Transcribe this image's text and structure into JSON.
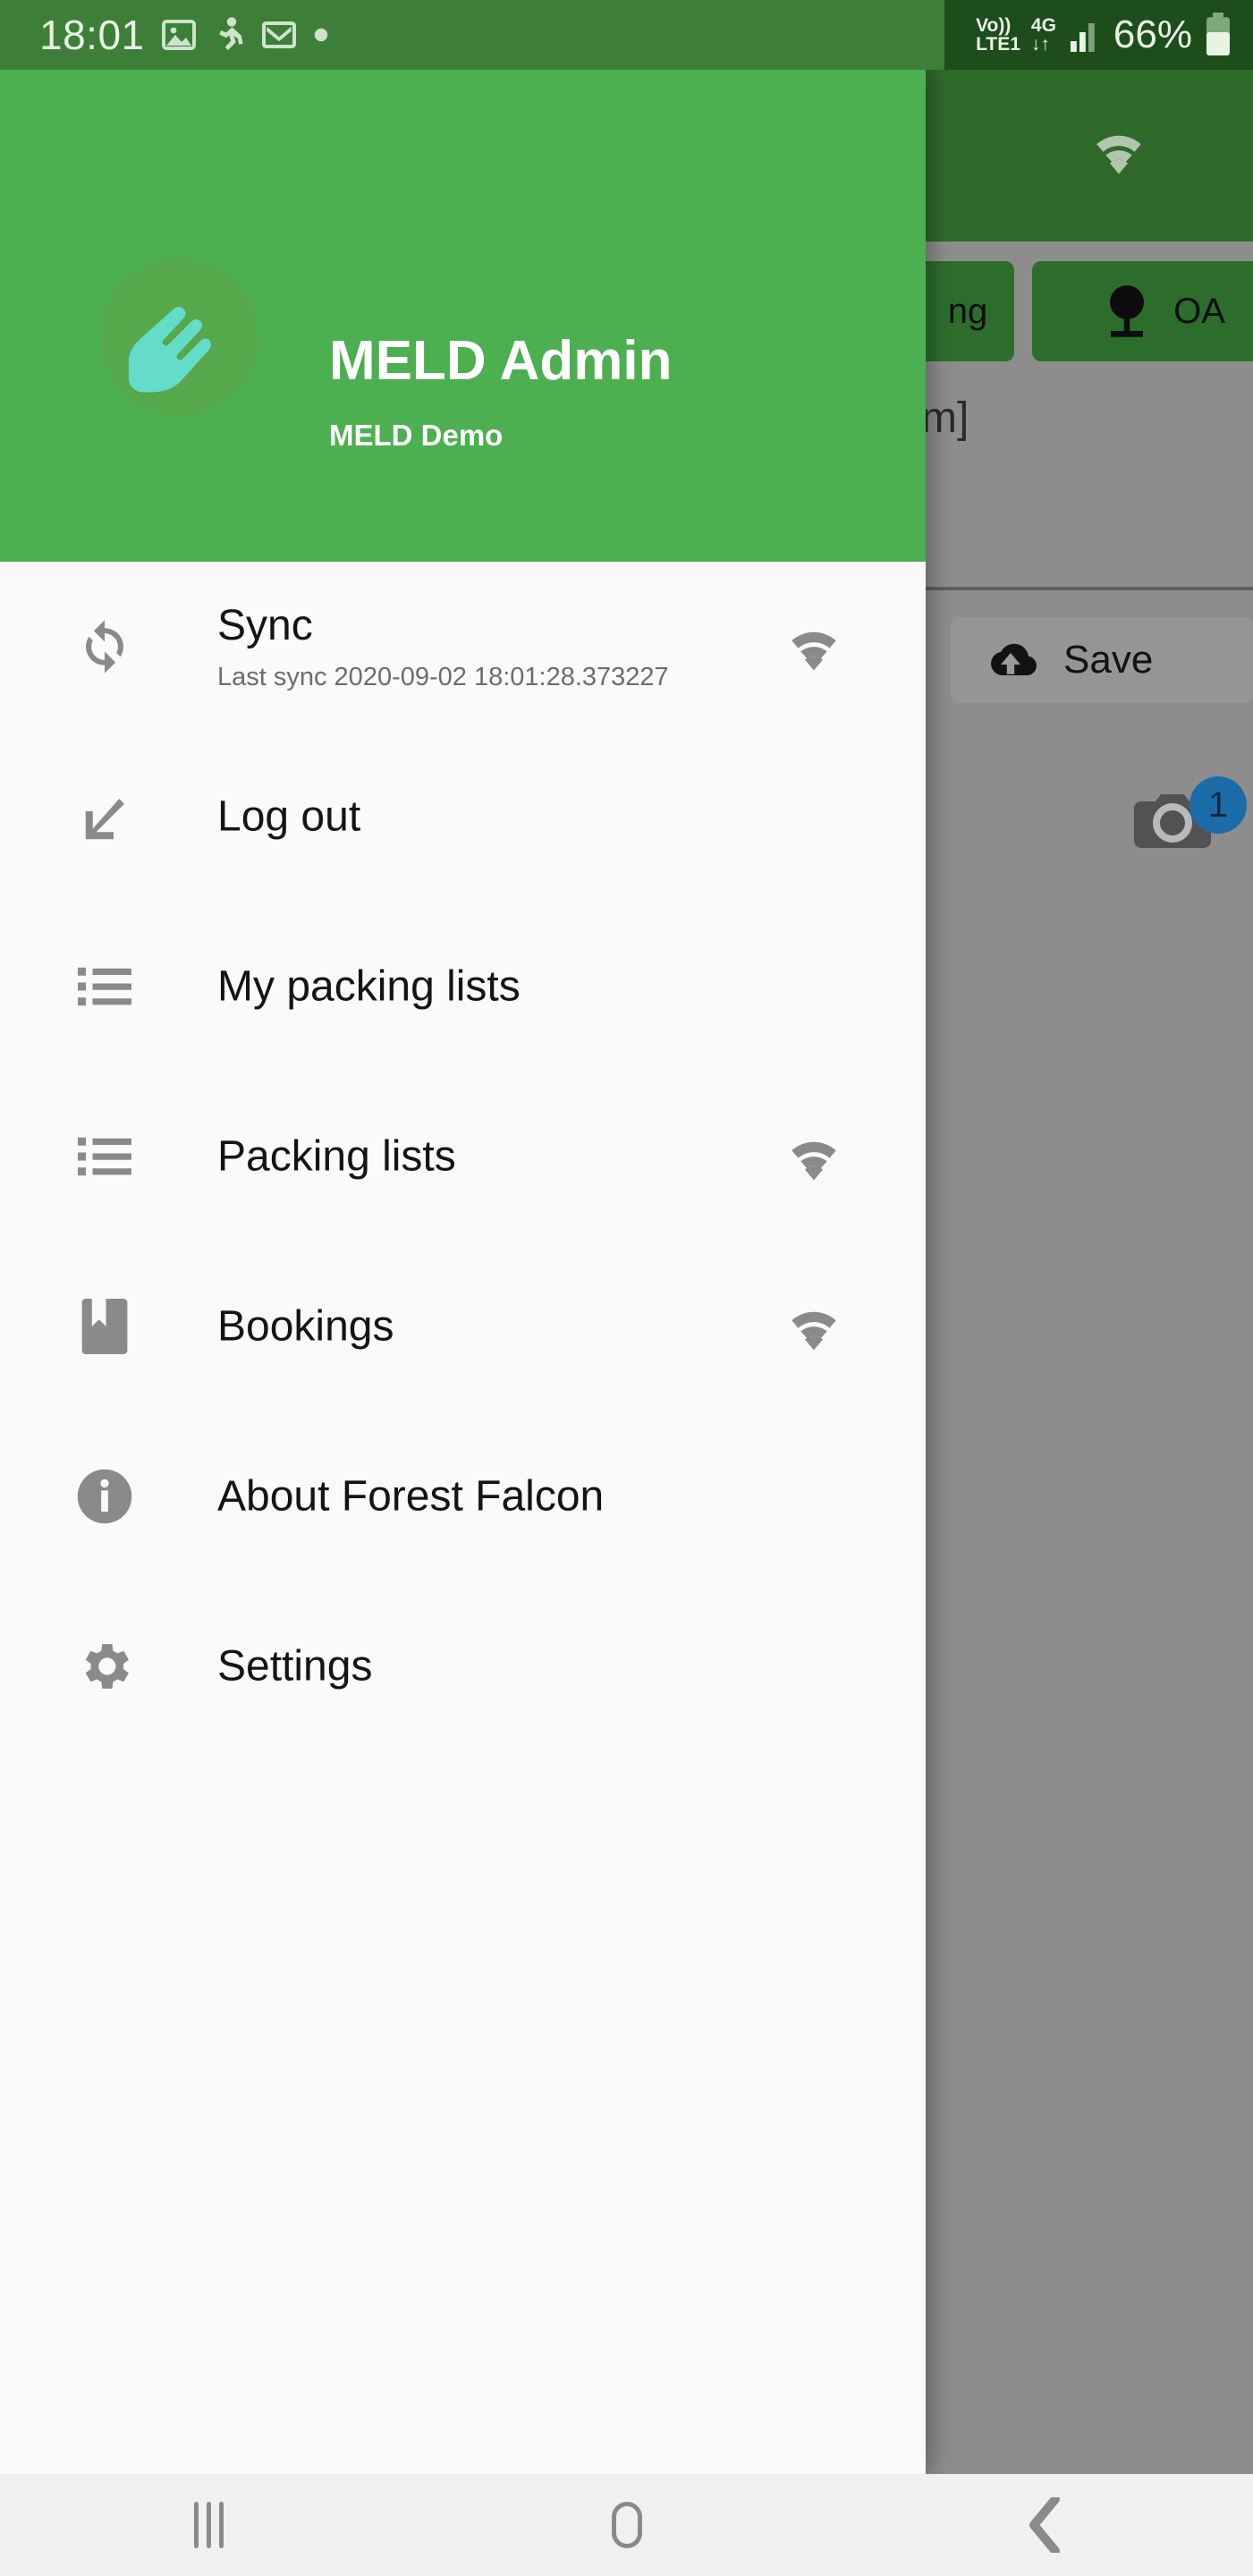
{
  "status_bar": {
    "time": "18:01",
    "left_icons": [
      "image-icon",
      "running-person-icon",
      "gmail-icon",
      "dot-icon"
    ],
    "voice_label": "Vo))",
    "network_label": "LTE1",
    "generation_label": "4G",
    "data_arrows": "↓↑",
    "battery_percent": "66%",
    "bg_color": "#3d7f38",
    "shade_color": "#1e4d1c",
    "text_color": "#e8f3e6"
  },
  "drawer": {
    "header": {
      "title": "MELD Admin",
      "subtitle": "MELD Demo",
      "avatar_name": "meld-logo-avatar",
      "bg_color": "#4caf50",
      "text_color": "#ffffff"
    },
    "items": [
      {
        "label": "Sync",
        "sub": "Last sync 2020-09-02 18:01:28.373227",
        "icon": "sync-icon",
        "trailing_icon": "wifi-icon"
      },
      {
        "label": "Log out",
        "sub": "",
        "icon": "logout-arrow-icon",
        "trailing_icon": ""
      },
      {
        "label": "My packing lists",
        "sub": "",
        "icon": "list-icon",
        "trailing_icon": ""
      },
      {
        "label": "Packing lists",
        "sub": "",
        "icon": "list-icon",
        "trailing_icon": "wifi-icon"
      },
      {
        "label": "Bookings",
        "sub": "",
        "icon": "bookmark-icon",
        "trailing_icon": "wifi-icon"
      },
      {
        "label": "About Forest Falcon",
        "sub": "",
        "icon": "info-circle-icon",
        "trailing_icon": ""
      },
      {
        "label": "Settings",
        "sub": "",
        "icon": "gear-icon",
        "trailing_icon": ""
      }
    ],
    "bg_color": "#fafafa",
    "label_color": "#141414",
    "sub_color": "#6d6d6d"
  },
  "background_screen": {
    "appbar_wifi_icon": "wifi-icon",
    "appbar_color": "#2f6a2b",
    "chip_1_label": "ng",
    "chip_2_icon": "tree-icon",
    "chip_2_label": "OA",
    "chip_color": "#2d6d2c",
    "text_fragment": "m]",
    "save_button_label": "Save",
    "save_button_icon": "cloud-upload-icon",
    "camera_icon": "camera-icon",
    "camera_badge_count": "1",
    "camera_badge_color": "#1b6ca8",
    "scrim_color": "#8d8d8d"
  },
  "nav_bar": {
    "recents_label": "recents-icon",
    "home_label": "home-icon",
    "back_label": "back-icon",
    "bg_color": "#f0f0f0",
    "icon_color": "#8a8a8a"
  }
}
